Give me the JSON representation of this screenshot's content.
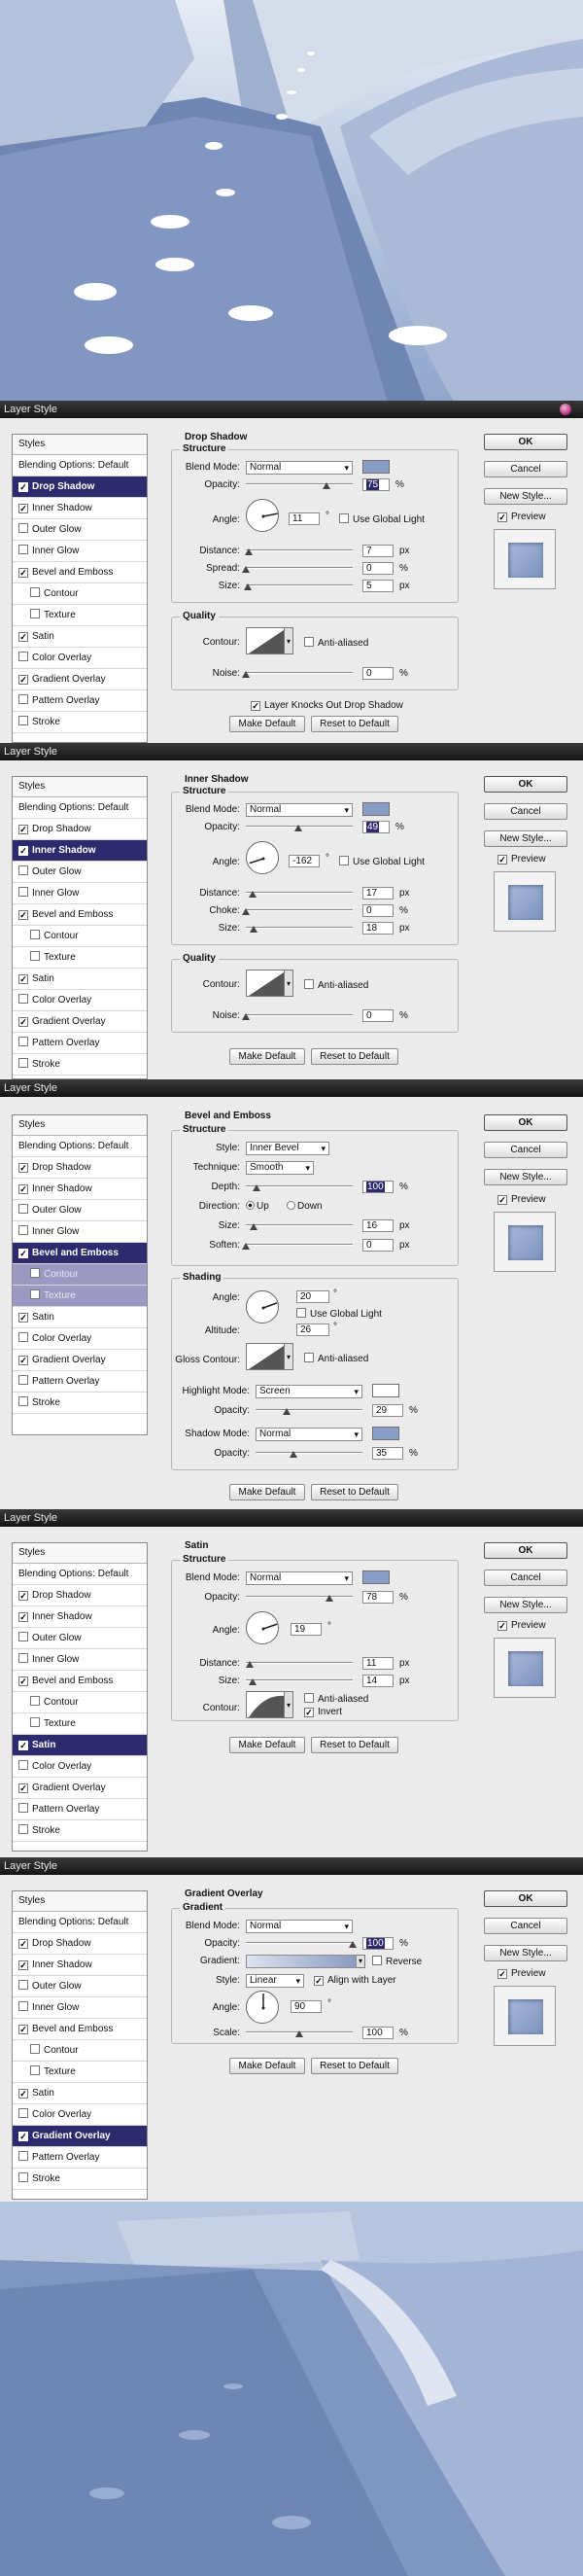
{
  "window_title": "Layer Style",
  "styles_header": "Styles",
  "blending_options": "Blending Options: Default",
  "styles_list": [
    "Drop Shadow",
    "Inner Shadow",
    "Outer Glow",
    "Inner Glow",
    "Bevel and Emboss",
    "Contour",
    "Texture",
    "Satin",
    "Color Overlay",
    "Gradient Overlay",
    "Pattern Overlay",
    "Stroke"
  ],
  "buttons": {
    "ok": "OK",
    "cancel": "Cancel",
    "new_style": "New Style...",
    "preview": "Preview",
    "make_default": "Make Default",
    "reset_default": "Reset to Default"
  },
  "colors": {
    "selected_bg": "#2e2a6e",
    "swatch": "#8a9dc4",
    "titlebar": "#1c1c1c"
  },
  "common": {
    "structure": "Structure",
    "quality": "Quality",
    "blend_mode": "Blend Mode:",
    "opacity": "Opacity:",
    "angle": "Angle:",
    "distance": "Distance:",
    "size": "Size:",
    "contour": "Contour:",
    "noise": "Noise:",
    "anti_aliased": "Anti-aliased",
    "use_global_light": "Use Global Light",
    "normal": "Normal",
    "px": "px",
    "pct": "%",
    "deg": "°"
  },
  "drop_shadow": {
    "title": "Drop Shadow",
    "opacity": "75",
    "opacity_frac": 0.75,
    "angle": "11",
    "angle_deg": 11,
    "distance": "7",
    "distance_frac": 0.03,
    "spread_label": "Spread:",
    "spread": "0",
    "spread_frac": 0,
    "size": "5",
    "size_frac": 0.02,
    "noise": "0",
    "layer_knocks": "Layer Knocks Out Drop Shadow"
  },
  "inner_shadow": {
    "title": "Inner Shadow",
    "opacity": "49",
    "opacity_frac": 0.49,
    "angle": "-162",
    "angle_deg": -162,
    "distance": "17",
    "distance_frac": 0.06,
    "choke_label": "Choke:",
    "choke": "0",
    "choke_frac": 0,
    "size": "18",
    "size_frac": 0.07,
    "noise": "0"
  },
  "bevel": {
    "title": "Bevel and Emboss",
    "style_label": "Style:",
    "style": "Inner Bevel",
    "technique_label": "Technique:",
    "technique": "Smooth",
    "depth_label": "Depth:",
    "depth": "100",
    "depth_frac": 0.1,
    "direction_label": "Direction:",
    "up": "Up",
    "down": "Down",
    "size": "16",
    "size_frac": 0.07,
    "soften_label": "Soften:",
    "soften": "0",
    "soften_frac": 0,
    "shading": "Shading",
    "angle": "20",
    "angle_deg": 20,
    "altitude_label": "Altitude:",
    "altitude": "26",
    "gloss_contour": "Gloss Contour:",
    "highlight_mode_label": "Highlight Mode:",
    "highlight_mode": "Screen",
    "highlight_opacity": "29",
    "highlight_frac": 0.29,
    "shadow_mode_label": "Shadow Mode:",
    "shadow_mode": "Normal",
    "shadow_opacity": "35",
    "shadow_frac": 0.35
  },
  "satin": {
    "title": "Satin",
    "opacity": "78",
    "opacity_frac": 0.78,
    "angle": "19",
    "angle_deg": 19,
    "distance": "11",
    "distance_frac": 0.04,
    "size": "14",
    "size_frac": 0.06,
    "invert": "Invert"
  },
  "gradient_overlay": {
    "title": "Gradient Overlay",
    "section": "Gradient",
    "opacity": "100",
    "opacity_frac": 1.0,
    "gradient_label": "Gradient:",
    "reverse": "Reverse",
    "style_label": "Style:",
    "style": "Linear",
    "align_with_layer": "Align with Layer",
    "angle": "90",
    "angle_deg": 90,
    "scale_label": "Scale:",
    "scale": "100",
    "scale_frac": 0.5
  }
}
